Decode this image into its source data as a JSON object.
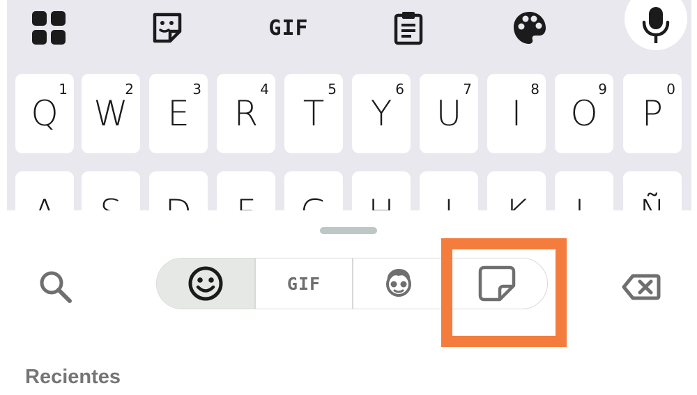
{
  "toolbar": {
    "items": [
      {
        "icon": "apps-grid-icon"
      },
      {
        "icon": "sticker-face-icon"
      },
      {
        "label": "GIF"
      },
      {
        "icon": "clipboard-icon"
      },
      {
        "icon": "palette-icon"
      },
      {
        "icon": "microphone-icon"
      }
    ]
  },
  "keys": {
    "row1": [
      {
        "letter": "Q",
        "num": "1"
      },
      {
        "letter": "W",
        "num": "2"
      },
      {
        "letter": "E",
        "num": "3"
      },
      {
        "letter": "R",
        "num": "4"
      },
      {
        "letter": "T",
        "num": "5"
      },
      {
        "letter": "Y",
        "num": "6"
      },
      {
        "letter": "U",
        "num": "7"
      },
      {
        "letter": "I",
        "num": "8"
      },
      {
        "letter": "O",
        "num": "9"
      },
      {
        "letter": "P",
        "num": "0"
      }
    ],
    "row2": [
      "A",
      "S",
      "D",
      "F",
      "G",
      "H",
      "J",
      "K",
      "L",
      "Ñ"
    ]
  },
  "panel": {
    "tabs": [
      {
        "name": "emoji",
        "icon": "smiley-icon",
        "active": true
      },
      {
        "name": "gif",
        "label": "GIF"
      },
      {
        "name": "avatar",
        "icon": "avatar-face-icon"
      },
      {
        "name": "stickers",
        "icon": "sticker-icon"
      }
    ],
    "section_title": "Recientes"
  },
  "colors": {
    "keyboard_bg": "#e9e8ef",
    "highlight": "#f47c3c",
    "icon_dark": "#1b1b1b",
    "icon_grey": "#6f6f6f"
  }
}
